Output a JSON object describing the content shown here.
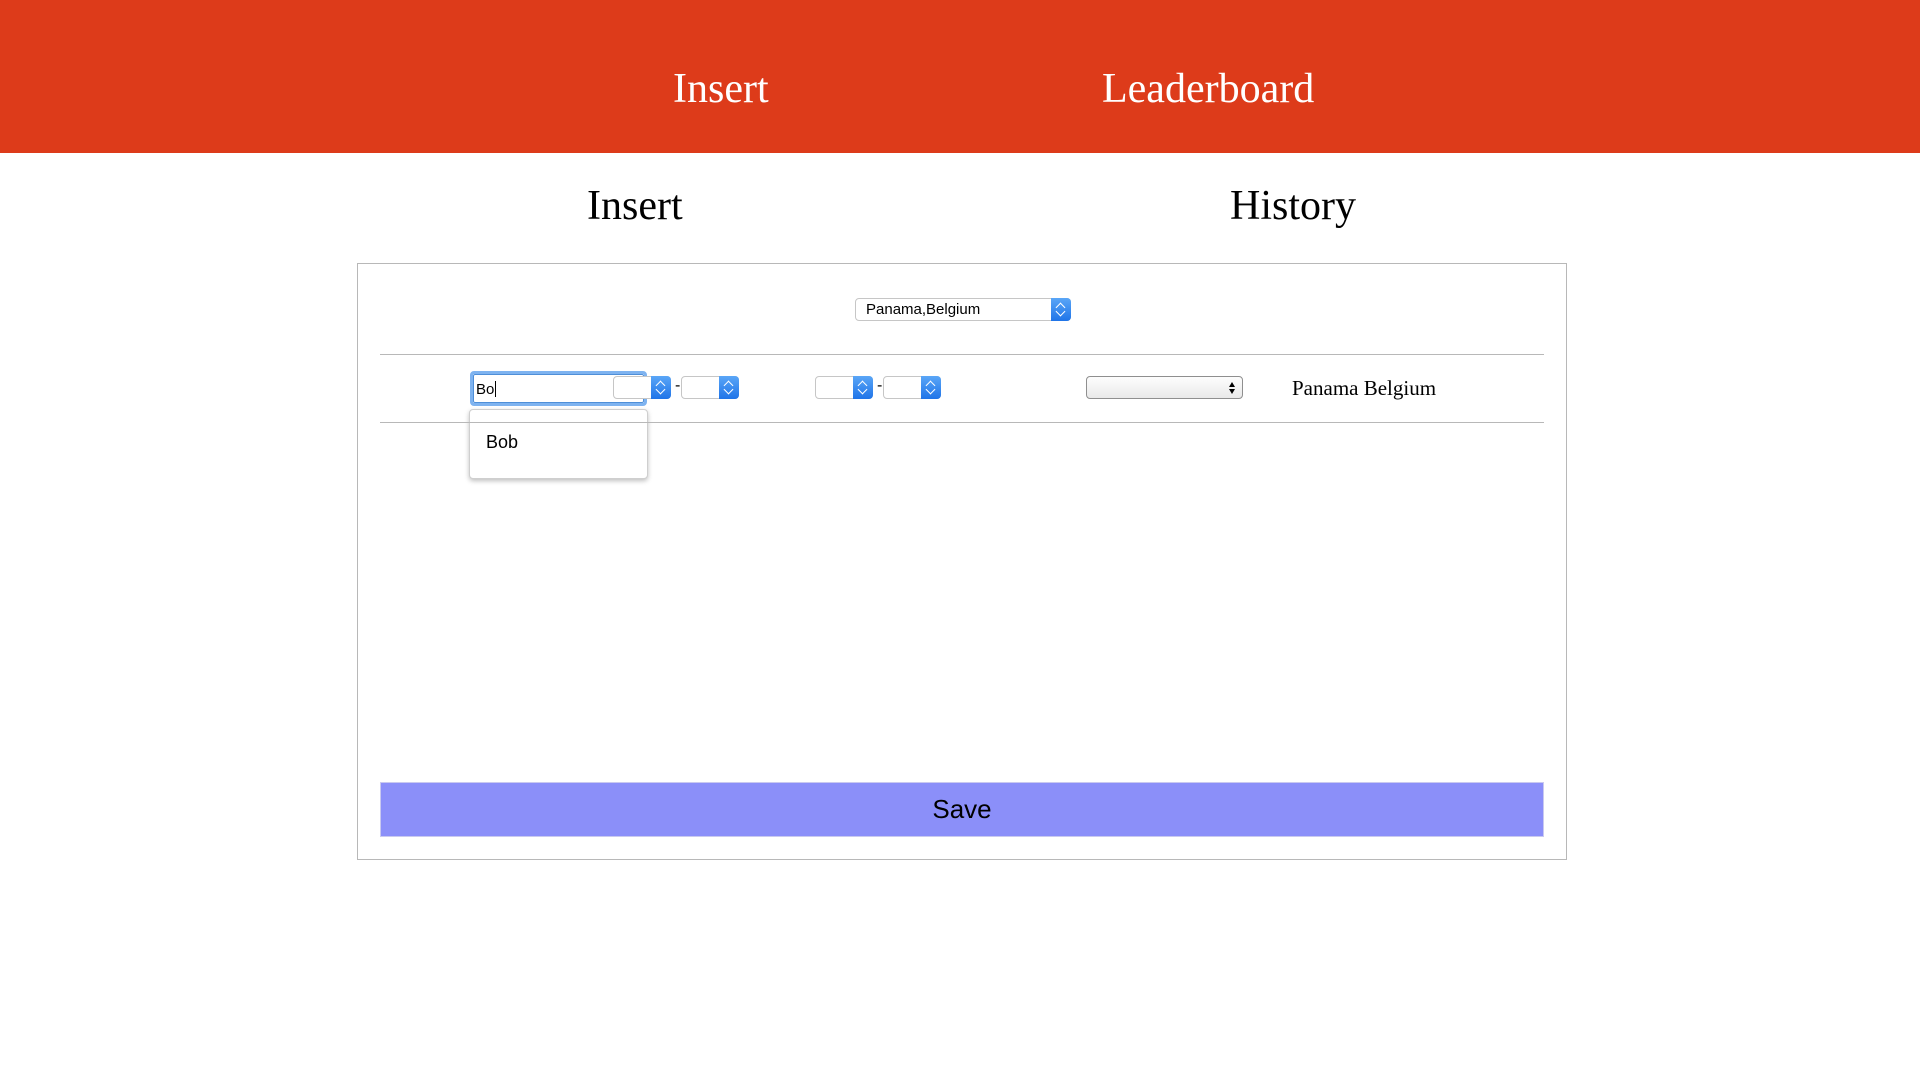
{
  "nav": {
    "insert": "Insert",
    "leaderboard": "Leaderboard"
  },
  "tabs": {
    "insert": "Insert",
    "history": "History"
  },
  "form": {
    "match_select_value": "Panama,Belgium",
    "player_input_value": "Bo",
    "player_suggestions": [
      "Bob"
    ],
    "first_score_home": "",
    "first_score_away": "",
    "second_score_home": "",
    "second_score_away": "",
    "winner_select_value": "",
    "teams_label": "Panama Belgium",
    "save_label": "Save"
  },
  "colors": {
    "header_bg": "#dd3b1a",
    "save_bg": "#8b8ff9",
    "focus_ring": "#7eb3f0",
    "spinner_blue": "#1f74e8"
  }
}
